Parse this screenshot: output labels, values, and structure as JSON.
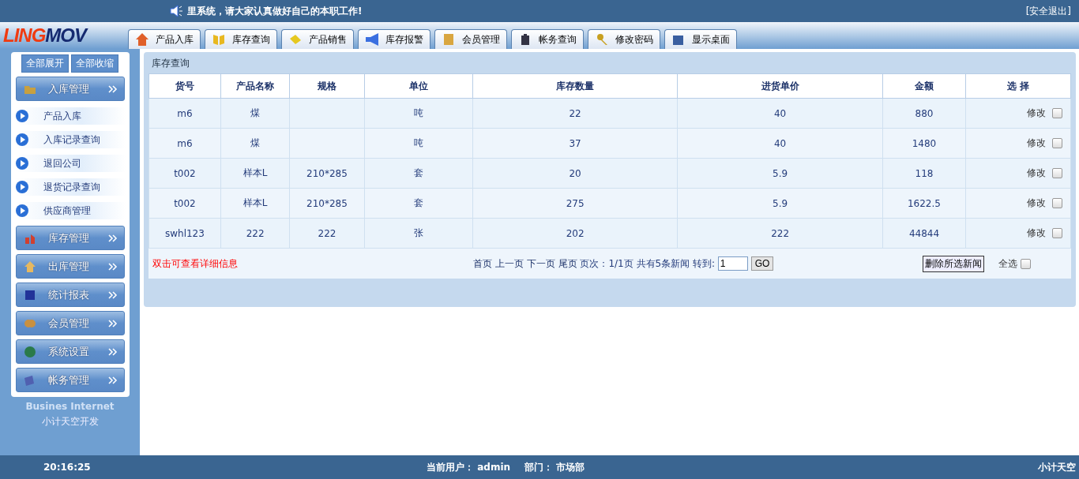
{
  "top_bar": {
    "notice": "里系统，请大家认真做好自己的本职工作!",
    "logout": "[安全退出]"
  },
  "logo": {
    "part_1": "LING",
    "part_2": "MOV"
  },
  "tabs": [
    {
      "label": "产品入库"
    },
    {
      "label": "库存查询"
    },
    {
      "label": "产品销售"
    },
    {
      "label": "库存报警"
    },
    {
      "label": "会员管理"
    },
    {
      "label": "帐务查询"
    },
    {
      "label": "修改密码"
    },
    {
      "label": "显示桌面"
    }
  ],
  "sidebar": {
    "expand_all": "全部展开",
    "collapse_all": "全部收缩",
    "groups": [
      {
        "label": "入库管理",
        "items": [
          "产品入库",
          "入库记录查询",
          "退回公司",
          "退货记录查询",
          "供应商管理"
        ]
      },
      {
        "label": "库存管理"
      },
      {
        "label": "出库管理"
      },
      {
        "label": "统计报表"
      },
      {
        "label": "会员管理"
      },
      {
        "label": "系统设置"
      },
      {
        "label": "帐务管理"
      }
    ],
    "footer_1": "Busines Internet",
    "footer_2": "小计天空开发"
  },
  "panel": {
    "title": "库存查询",
    "table": {
      "columns": [
        "货号",
        "产品名称",
        "规格",
        "单位",
        "库存数量",
        "进货单价",
        "金额",
        "选 择"
      ],
      "rows": [
        {
          "cells": [
            "m6",
            "煤",
            "",
            "吨",
            "22",
            "40",
            "880"
          ],
          "action": "修改",
          "checked": false
        },
        {
          "cells": [
            "m6",
            "煤",
            "",
            "吨",
            "37",
            "40",
            "1480"
          ],
          "action": "修改",
          "checked": false
        },
        {
          "cells": [
            "t002",
            "样本L",
            "210*285",
            "套",
            "20",
            "5.9",
            "118"
          ],
          "action": "修改",
          "checked": false
        },
        {
          "cells": [
            "t002",
            "样本L",
            "210*285",
            "套",
            "275",
            "5.9",
            "1622.5"
          ],
          "action": "修改",
          "checked": false
        },
        {
          "cells": [
            "swhl123",
            "222",
            "222",
            "张",
            "202",
            "222",
            "44844"
          ],
          "action": "修改",
          "checked": false
        }
      ]
    },
    "hint": "双击可查看详细信息",
    "pager": {
      "first": "首页",
      "prev": "上一页",
      "next": "下一页",
      "last": "尾页",
      "info": "页次：1/1页 共有5条新闻 转到:",
      "page_value": "1",
      "go": "GO"
    },
    "delete_button": "删除所选新闻",
    "select_all": "全选",
    "select_all_checked": false
  },
  "status_bar": {
    "time": "20:16:25",
    "user_label": "当前用户：",
    "user": "admin",
    "dept_label": "部门：",
    "dept": "市场部",
    "right": "小计天空"
  }
}
